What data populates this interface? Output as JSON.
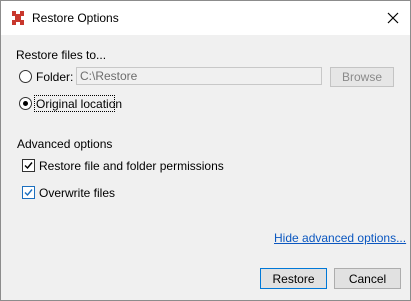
{
  "window": {
    "title": "Restore Options"
  },
  "restore_to": {
    "heading": "Restore files to...",
    "folder_label": "Folder:",
    "folder_value": "C:\\Restore",
    "browse_label": "Browse",
    "original_label": "Original location",
    "selected": "original"
  },
  "advanced": {
    "heading": "Advanced options",
    "permissions_label": "Restore file and folder permissions",
    "permissions_checked": true,
    "overwrite_label": "Overwrite files",
    "overwrite_checked": true,
    "toggle_link": "Hide advanced options..."
  },
  "footer": {
    "restore_label": "Restore",
    "cancel_label": "Cancel"
  },
  "colors": {
    "app_icon": "#c8372d",
    "link": "#0b57c0",
    "default_button_border": "#0078d7"
  },
  "icons": {
    "app": "app-logo-icon",
    "close": "close-icon"
  }
}
